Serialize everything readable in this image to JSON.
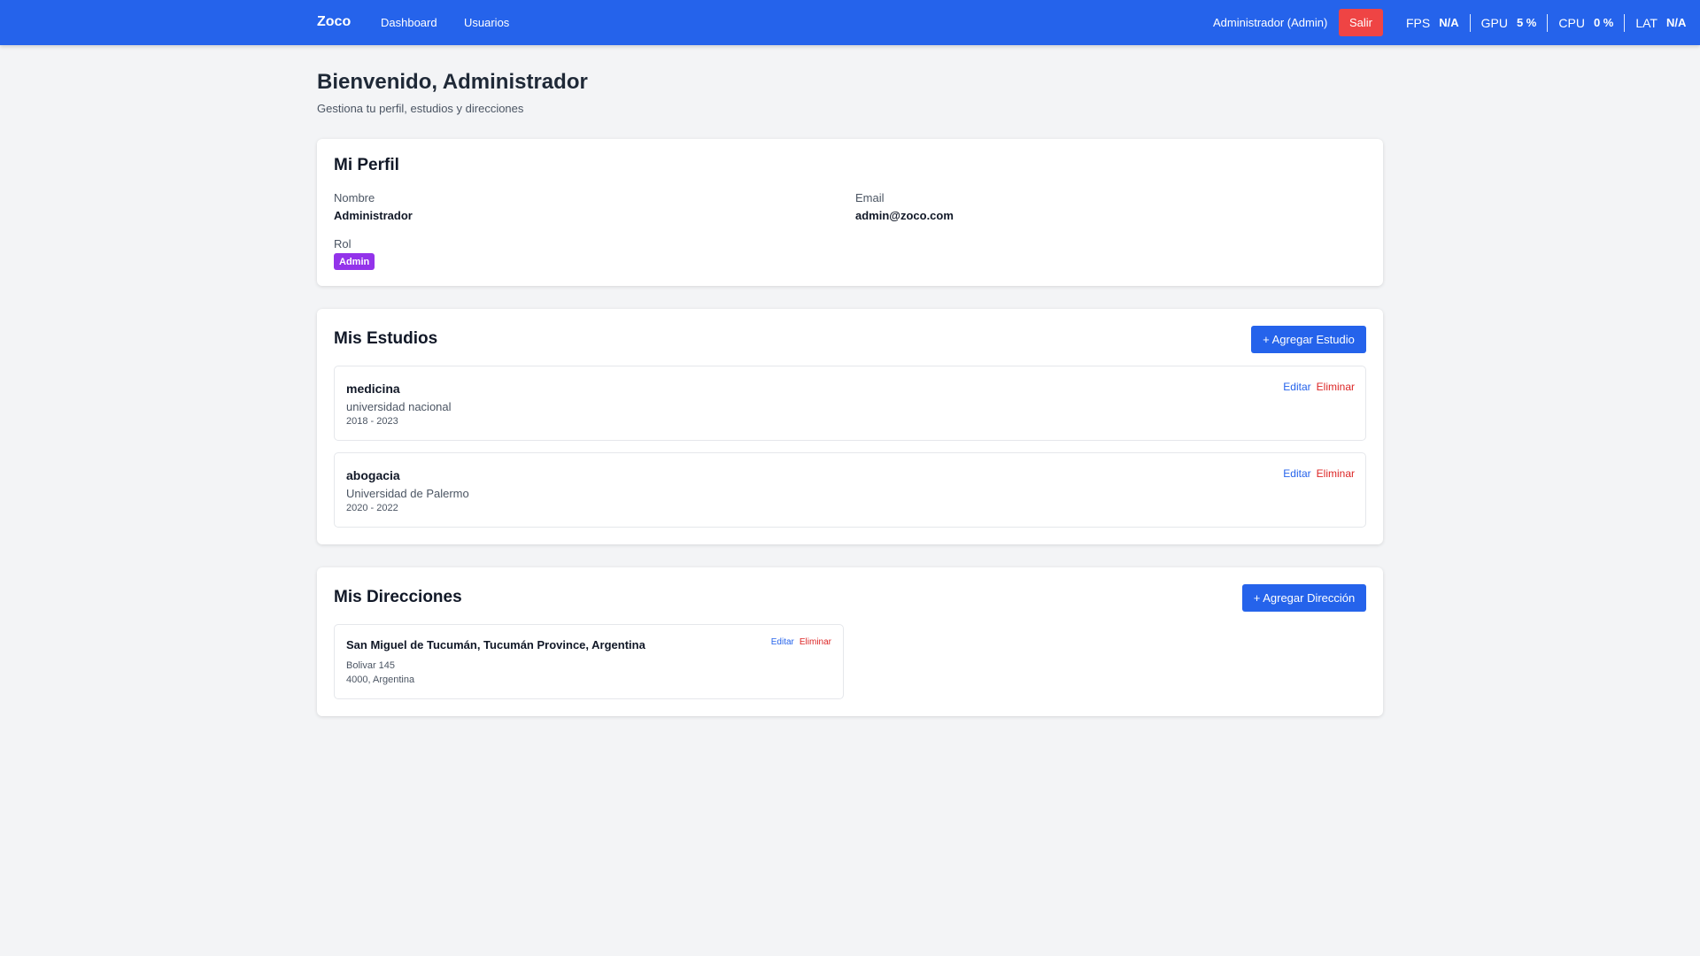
{
  "navbar": {
    "brand": "Zoco",
    "links": [
      "Dashboard",
      "Usuarios"
    ],
    "user_label": "Administrador (Admin)",
    "logout_label": "Salir",
    "color": "#2563eb"
  },
  "stats": [
    {
      "label": "FPS",
      "value": "N/A"
    },
    {
      "label": "GPU",
      "value": "5 %"
    },
    {
      "label": "CPU",
      "value": "0 %"
    },
    {
      "label": "LAT",
      "value": "N/A"
    }
  ],
  "header": {
    "title": "Bienvenido, Administrador",
    "subtitle": "Gestiona tu perfil, estudios y direcciones"
  },
  "profile": {
    "title": "Mi Perfil",
    "name_label": "Nombre",
    "name_value": "Administrador",
    "email_label": "Email",
    "email_value": "admin@zoco.com",
    "role_label": "Rol",
    "role_value": "Admin"
  },
  "studies": {
    "title": "Mis Estudios",
    "add_label": "+ Agregar Estudio",
    "items": [
      {
        "name": "medicina",
        "institution": "universidad nacional",
        "years": "2018 - 2023",
        "edit": "Editar",
        "delete": "Eliminar"
      },
      {
        "name": "abogacia",
        "institution": "Universidad de Palermo",
        "years": "2020 - 2022",
        "edit": "Editar",
        "delete": "Eliminar"
      }
    ]
  },
  "addresses": {
    "title": "Mis Direcciones",
    "add_label": "+ Agregar Dirección",
    "items": [
      {
        "title": "San Miguel de Tucumán, Tucumán Province, Argentina",
        "street": "Bolivar 145",
        "postal": "4000, Argentina",
        "edit": "Editar",
        "delete": "Eliminar"
      }
    ]
  }
}
